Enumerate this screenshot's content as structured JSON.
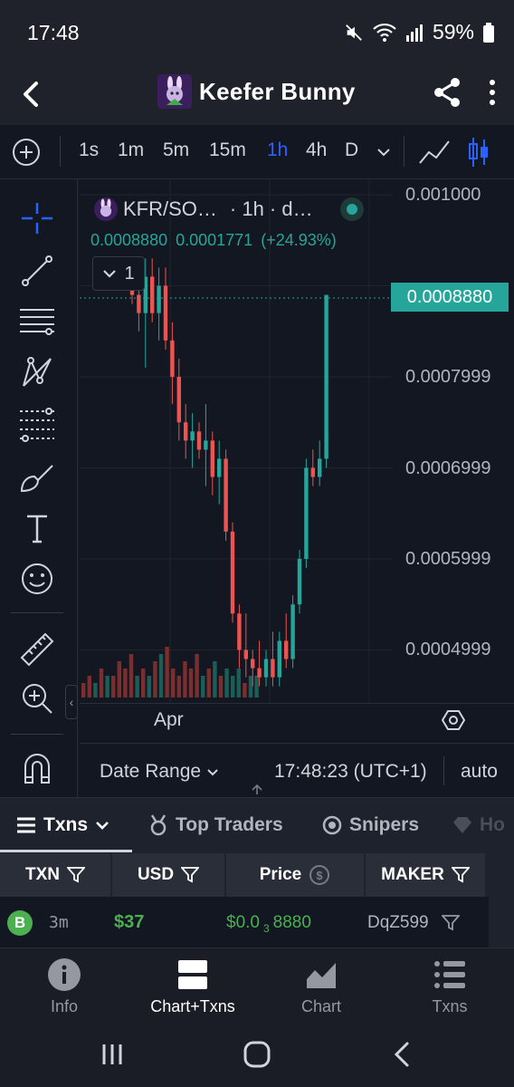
{
  "status": {
    "time": "17:48",
    "battery": "59%"
  },
  "header": {
    "title": "Keefer Bunny"
  },
  "timeframes": [
    {
      "label": "1s",
      "active": false
    },
    {
      "label": "1m",
      "active": false
    },
    {
      "label": "5m",
      "active": false
    },
    {
      "label": "15m",
      "active": false
    },
    {
      "label": "1h",
      "active": true
    },
    {
      "label": "4h",
      "active": false
    },
    {
      "label": "D",
      "active": false
    }
  ],
  "legend": {
    "symbol": "KFR/SO…",
    "interval": "· 1h · d…",
    "last": "0.0008880",
    "change": "0.0001771",
    "change_pct": "(+24.93%)",
    "indicator_count": "1"
  },
  "price_axis": [
    "0.001000",
    "0.0007999",
    "0.0006999",
    "0.0005999",
    "0.0004999"
  ],
  "last_price_label": "0.0008880",
  "x_axis_label": "Apr",
  "chart_footer": {
    "date_range": "Date Range",
    "clock": "17:48:23 (UTC+1)",
    "scale": "auto"
  },
  "tabs": [
    {
      "label": "Txns",
      "active": true
    },
    {
      "label": "Top Traders",
      "active": false
    },
    {
      "label": "Snipers",
      "active": false
    },
    {
      "label": "Ho",
      "active": false
    }
  ],
  "table": {
    "headers": [
      "TXN",
      "USD",
      "Price",
      "MAKER"
    ],
    "rows": [
      {
        "type": "B",
        "age": "3m",
        "usd": "$37",
        "price_prefix": "$0.0",
        "price_sub": "3",
        "price_suffix": "8880",
        "maker": "DqZ599"
      }
    ]
  },
  "nav": [
    {
      "label": "Info",
      "active": false
    },
    {
      "label": "Chart+Txns",
      "active": true
    },
    {
      "label": "Chart",
      "active": false
    },
    {
      "label": "Txns",
      "active": false
    }
  ],
  "colors": {
    "up": "#26a69a",
    "down": "#ef5350",
    "accent": "#2962ff",
    "bg": "#131722"
  },
  "candles": [
    {
      "o": 0.0009,
      "h": 0.00093,
      "l": 0.00088,
      "c": 0.00089
    },
    {
      "o": 0.00089,
      "h": 0.0009,
      "l": 0.00085,
      "c": 0.00087
    },
    {
      "o": 0.00087,
      "h": 0.00093,
      "l": 0.00081,
      "c": 0.00091
    },
    {
      "o": 0.00091,
      "h": 0.00093,
      "l": 0.00086,
      "c": 0.00087
    },
    {
      "o": 0.00087,
      "h": 0.00092,
      "l": 0.00084,
      "c": 0.0009
    },
    {
      "o": 0.0009,
      "h": 0.00092,
      "l": 0.00083,
      "c": 0.00084
    },
    {
      "o": 0.00084,
      "h": 0.00086,
      "l": 0.00077,
      "c": 0.0008
    },
    {
      "o": 0.0008,
      "h": 0.00082,
      "l": 0.00073,
      "c": 0.00075
    },
    {
      "o": 0.00075,
      "h": 0.00077,
      "l": 0.00071,
      "c": 0.00073
    },
    {
      "o": 0.00073,
      "h": 0.00076,
      "l": 0.0007,
      "c": 0.00074
    },
    {
      "o": 0.00074,
      "h": 0.00075,
      "l": 0.00071,
      "c": 0.00072
    },
    {
      "o": 0.00072,
      "h": 0.00077,
      "l": 0.00068,
      "c": 0.00073
    },
    {
      "o": 0.00073,
      "h": 0.00074,
      "l": 0.00067,
      "c": 0.00069
    },
    {
      "o": 0.00069,
      "h": 0.00073,
      "l": 0.00066,
      "c": 0.00071
    },
    {
      "o": 0.00071,
      "h": 0.00072,
      "l": 0.00062,
      "c": 0.00063
    },
    {
      "o": 0.00063,
      "h": 0.00064,
      "l": 0.00053,
      "c": 0.00054
    },
    {
      "o": 0.00054,
      "h": 0.00055,
      "l": 0.00048,
      "c": 0.0005
    },
    {
      "o": 0.0005,
      "h": 0.00054,
      "l": 0.00047,
      "c": 0.00049
    },
    {
      "o": 0.00049,
      "h": 0.0005,
      "l": 0.00046,
      "c": 0.00048
    },
    {
      "o": 0.00048,
      "h": 0.00051,
      "l": 0.00046,
      "c": 0.00047
    },
    {
      "o": 0.00047,
      "h": 0.0005,
      "l": 0.00046,
      "c": 0.00049
    },
    {
      "o": 0.00049,
      "h": 0.00052,
      "l": 0.00046,
      "c": 0.00047
    },
    {
      "o": 0.00047,
      "h": 0.00052,
      "l": 0.00046,
      "c": 0.00051
    },
    {
      "o": 0.00051,
      "h": 0.00054,
      "l": 0.00048,
      "c": 0.00049
    },
    {
      "o": 0.00049,
      "h": 0.00056,
      "l": 0.00048,
      "c": 0.00055
    },
    {
      "o": 0.00055,
      "h": 0.00061,
      "l": 0.00054,
      "c": 0.0006
    },
    {
      "o": 0.0006,
      "h": 0.00071,
      "l": 0.00059,
      "c": 0.0007
    },
    {
      "o": 0.0007,
      "h": 0.00072,
      "l": 0.00068,
      "c": 0.00069
    },
    {
      "o": 0.00069,
      "h": 0.00073,
      "l": 0.00068,
      "c": 0.00071
    },
    {
      "o": 0.00071,
      "h": 0.00089,
      "l": 0.0007,
      "c": 0.00089
    }
  ],
  "volumes": [
    2,
    3,
    2,
    4,
    3,
    3,
    5,
    4,
    6,
    3,
    4,
    3,
    5,
    6,
    7,
    4,
    3,
    5,
    4,
    6,
    3,
    4,
    5,
    3,
    4,
    3,
    4,
    2,
    3,
    3
  ]
}
